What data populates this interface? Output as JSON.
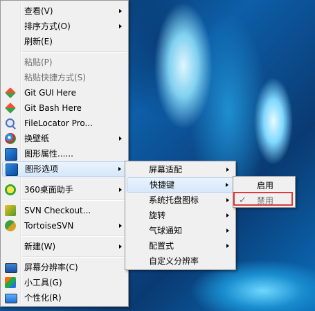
{
  "main_menu": {
    "items": [
      {
        "label": "查看(V)",
        "submenu": true
      },
      {
        "label": "排序方式(O)",
        "submenu": true
      },
      {
        "label": "刷新(E)"
      },
      {
        "label": "粘贴(P)",
        "disabled": true
      },
      {
        "label": "粘贴快捷方式(S)",
        "disabled": true
      },
      {
        "label": "Git GUI Here",
        "icon": "git-icon"
      },
      {
        "label": "Git Bash Here",
        "icon": "git-icon"
      },
      {
        "label": "FileLocator Pro...",
        "icon": "magnifier-icon"
      },
      {
        "label": "换壁纸",
        "icon": "wallpaper-icon",
        "submenu": true
      },
      {
        "label": "图形属性......",
        "icon": "graphics-icon"
      },
      {
        "label": "图形选项",
        "icon": "graphics-icon",
        "submenu": true,
        "highlighted": true
      },
      {
        "label": "360桌面助手",
        "icon": "360-icon",
        "submenu": true
      },
      {
        "label": "SVN Checkout...",
        "icon": "svn-checkout-icon"
      },
      {
        "label": "TortoiseSVN",
        "icon": "tortoisesvn-icon",
        "submenu": true
      },
      {
        "label": "新建(W)",
        "submenu": true
      },
      {
        "label": "屏幕分辨率(C)",
        "icon": "screen-icon"
      },
      {
        "label": "小工具(G)",
        "icon": "gadget-icon"
      },
      {
        "label": "个性化(R)",
        "icon": "personalize-icon"
      }
    ]
  },
  "graphics_submenu": {
    "items": [
      {
        "label": "屏幕适配",
        "submenu": true
      },
      {
        "label": "快捷键",
        "submenu": true,
        "highlighted": true
      },
      {
        "label": "系统托盘图标",
        "submenu": true
      },
      {
        "label": "旋转",
        "submenu": true
      },
      {
        "label": "气球通知",
        "submenu": true
      },
      {
        "label": "配置式",
        "submenu": true
      },
      {
        "label": "自定义分辨率"
      }
    ]
  },
  "hotkey_submenu": {
    "items": [
      {
        "label": "启用"
      },
      {
        "label": "禁用",
        "checked": true,
        "disabled": true
      }
    ],
    "check_glyph": "✓"
  },
  "colors": {
    "menu_bg": "#f0f0f0",
    "highlight": "#d6e8fb",
    "callout": "#e03a3a"
  }
}
